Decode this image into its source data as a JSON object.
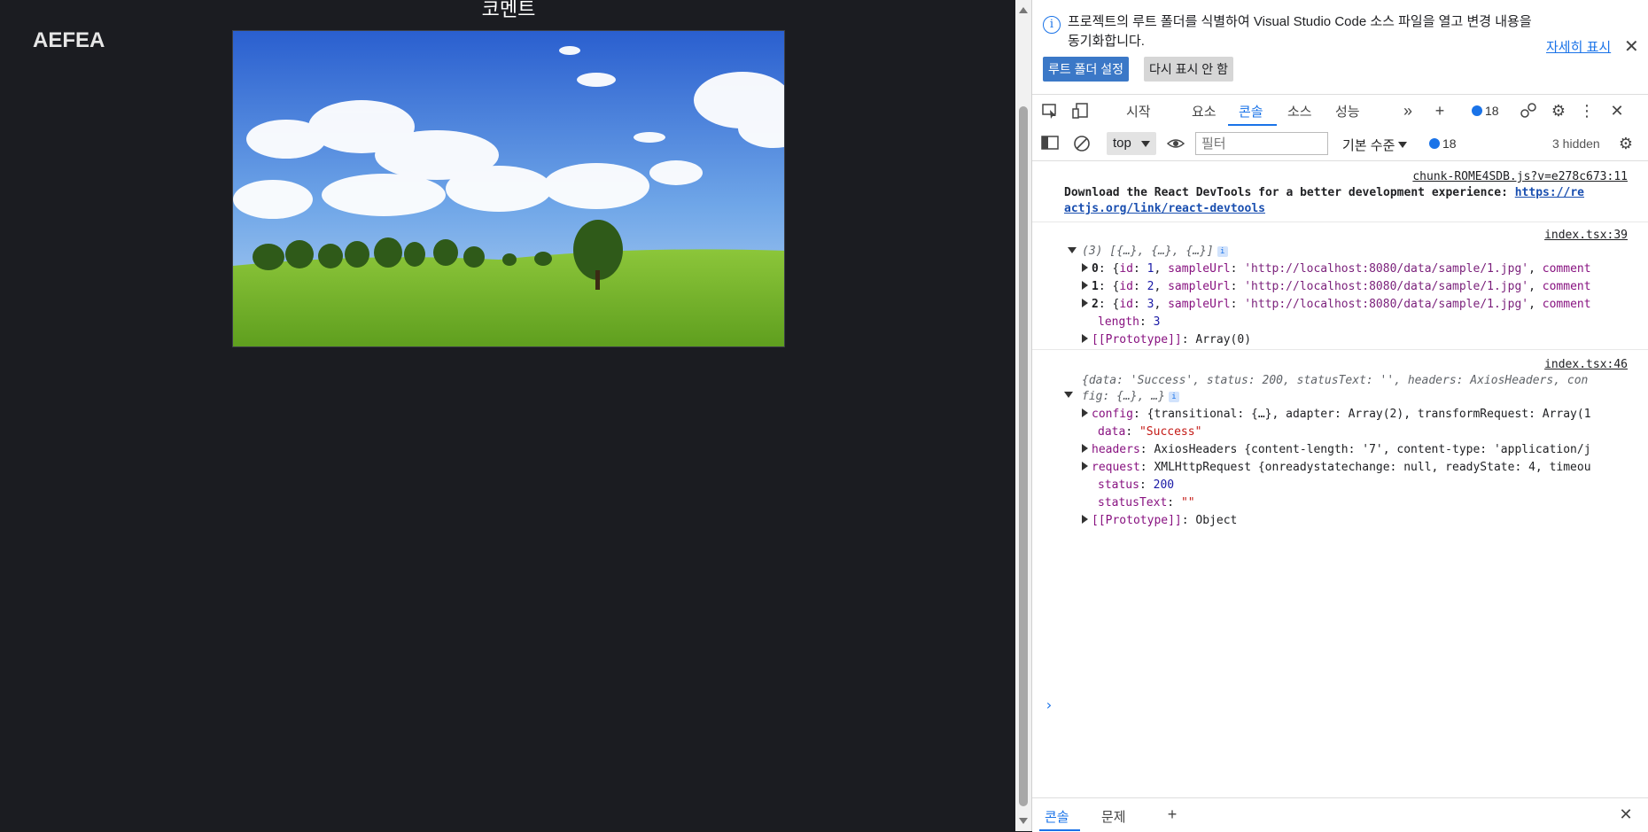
{
  "app": {
    "title": "AEFEA",
    "heading": "코멘트"
  },
  "devtools": {
    "banner": {
      "message": "프로젝트의 루트 폴더를 식별하여 Visual Studio Code 소스 파일을 열고 변경 내용을 동기화합니다.",
      "learn_more": "자세히 표시",
      "primary_button": "루트 폴더 설정",
      "secondary_button": "다시 표시 안 함"
    },
    "tabs": [
      "시작",
      "요소",
      "콘솔",
      "소스",
      "성능"
    ],
    "active_tab": "콘솔",
    "issues_count": "18",
    "toolbar": {
      "context": "top",
      "filter_placeholder": "필터",
      "levels": "기본 수준",
      "issues_count": "18",
      "hidden": "3 hidden"
    },
    "console": {
      "msg1": {
        "source": "chunk-ROME4SDB.js?v=e278c673:11",
        "text": "Download the React DevTools for a better development experience: ",
        "link_part1": "https://re",
        "link_part2": "actjs.org/link/react-devtools"
      },
      "msg2": {
        "source": "index.tsx:39",
        "summary": "(3) [{…}, {…}, {…}]",
        "items": [
          {
            "index": "0",
            "id": "1",
            "url": "'http://localhost:8080/data/sample/1.jpg'"
          },
          {
            "index": "1",
            "id": "2",
            "url": "'http://localhost:8080/data/sample/1.jpg'"
          },
          {
            "index": "2",
            "id": "3",
            "url": "'http://localhost:8080/data/sample/1.jpg'"
          }
        ],
        "length_value": "3",
        "prototype": "Array(0)"
      },
      "msg3": {
        "source": "index.tsx:46",
        "summary_line1": "{data: 'Success', status: 200, statusText: '', headers: AxiosHeaders, con",
        "summary_line2": "fig: {…}, …}",
        "config": "{transitional: {…}, adapter: Array(2), transformRequest: Array(1",
        "data": "\"Success\"",
        "headers": "AxiosHeaders {content-length: '7', content-type: 'application/j",
        "request": "XMLHttpRequest {onreadystatechange: null, readyState: 4, timeou",
        "status": "200",
        "statusText": "\"\"",
        "prototype": "Object"
      }
    },
    "drawer": {
      "tabs": [
        "콘솔",
        "문제"
      ]
    }
  },
  "colors": {
    "app_bg": "#1b1c21",
    "accent": "#1a73e8",
    "primary_button": "#3b78c7"
  }
}
